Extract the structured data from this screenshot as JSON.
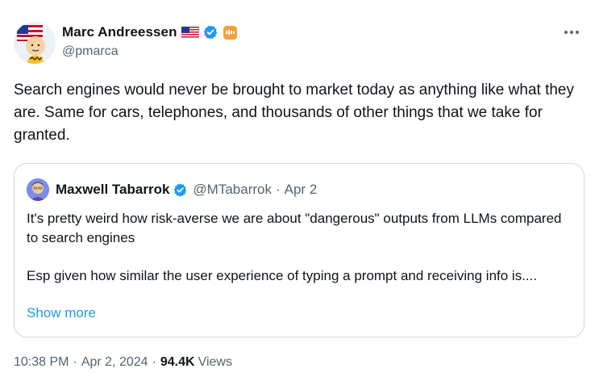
{
  "tweet": {
    "author": {
      "display_name": "Marc Andreessen",
      "handle": "@pmarca",
      "flag_icon": "us-flag-icon",
      "verified_icon": "verified-badge-icon",
      "affiliate_icon": "affiliate-badge-icon",
      "verified_color": "#1d9bf0"
    },
    "more_icon": "more-horizontal-icon",
    "text": "Search engines would never be brought to market today as anything like what they are. Same for cars, telephones, and thousands of other things that we take for granted.",
    "quote": {
      "display_name": "Maxwell Tabarrok",
      "handle": "@MTabarrok",
      "separator": "·",
      "date": "Apr 2",
      "text": "It's pretty weird how risk-averse we are about \"dangerous\" outputs from LLMs compared to search engines\n\nEsp given how similar the user experience of typing a prompt and receiving info is....",
      "show_more": "Show more"
    },
    "meta": {
      "time": "10:38 PM",
      "separator": "·",
      "date": "Apr 2, 2024",
      "views_count": "94.4K",
      "views_label": "Views"
    }
  }
}
